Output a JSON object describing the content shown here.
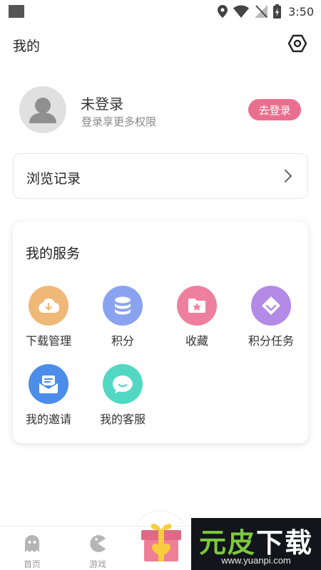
{
  "status_bar": {
    "time": "3:50"
  },
  "header": {
    "title": "我的"
  },
  "profile": {
    "name": "未登录",
    "subtitle": "登录享更多权限",
    "login_label": "去登录",
    "login_color": "#ea6f8e"
  },
  "history": {
    "label": "浏览记录"
  },
  "services": {
    "title": "我的服务",
    "items": [
      {
        "label": "下载管理",
        "icon": "download-cloud-icon",
        "color": "#efb877"
      },
      {
        "label": "积分",
        "icon": "coin-stack-icon",
        "color": "#8aa3f0"
      },
      {
        "label": "收藏",
        "icon": "star-folder-icon",
        "color": "#ee7f9e"
      },
      {
        "label": "积分任务",
        "icon": "diamond-tag-icon",
        "color": "#b38ae6"
      },
      {
        "label": "我的邀请",
        "icon": "invitation-mail-icon",
        "color": "#4b8de9"
      },
      {
        "label": "我的客服",
        "icon": "chat-bubble-icon",
        "color": "#52d8c2"
      }
    ]
  },
  "bottom_nav": {
    "items": [
      {
        "label": "首页",
        "icon": "ghost-home-icon"
      },
      {
        "label": "游戏",
        "icon": "pacman-game-icon"
      },
      {
        "label": "",
        "icon": "gift-box-icon"
      }
    ]
  },
  "watermark": {
    "left": "元",
    "middle": "皮",
    "right": "下载",
    "url": "www.yuanpi.com"
  }
}
